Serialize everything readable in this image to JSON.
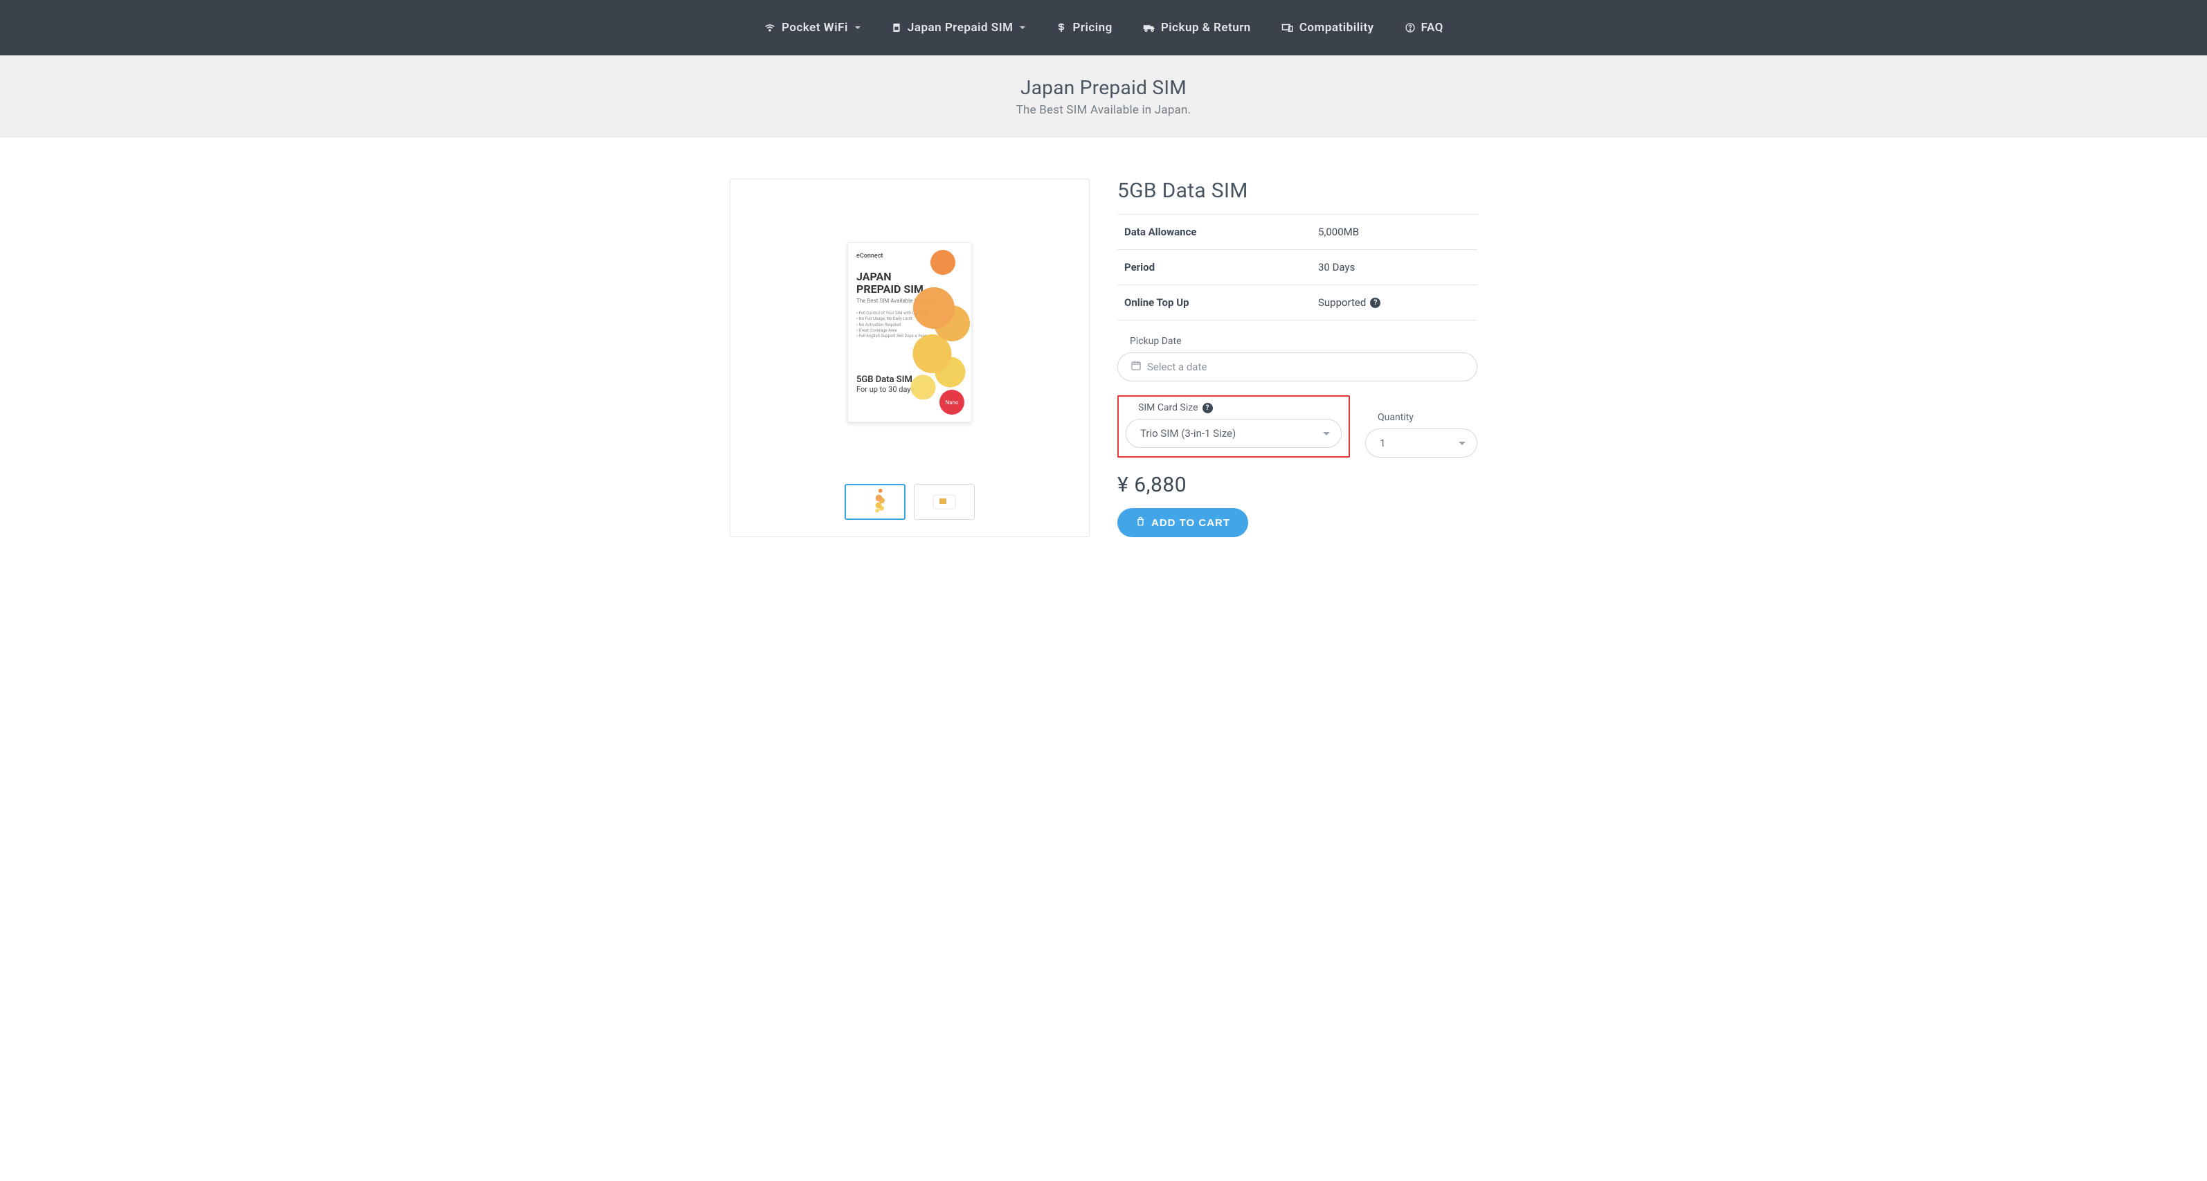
{
  "nav": {
    "items": [
      {
        "label": "Pocket WiFi",
        "has_dropdown": true
      },
      {
        "label": "Japan Prepaid SIM",
        "has_dropdown": true
      },
      {
        "label": "Pricing"
      },
      {
        "label": "Pickup & Return"
      },
      {
        "label": "Compatibility"
      },
      {
        "label": "FAQ"
      }
    ]
  },
  "hero": {
    "title": "Japan Prepaid SIM",
    "subtitle": "The Best SIM Available in Japan."
  },
  "product": {
    "title": "5GB Data SIM",
    "image": {
      "brand": "eConnect",
      "headline": "JAPAN\nPREPAID SIM",
      "tagline": "The Best SIM Available in Japan.",
      "bullets": "• Full Control of Your SIM with Our App\n• No Fair Usage, No Daily Limit\n• No Activation Required\n• Great Coverage Area\n• Full English Support 365 Days a Year",
      "data_line": "5GB Data SIM",
      "days_line": "For up to 30 days",
      "badge": "Nano"
    },
    "specs": [
      {
        "label": "Data Allowance",
        "value": "5,000MB"
      },
      {
        "label": "Period",
        "value": "30 Days"
      },
      {
        "label": "Online Top Up",
        "value": "Supported",
        "help": true
      }
    ],
    "pickup": {
      "label": "Pickup Date",
      "placeholder": "Select a date"
    },
    "sim_size": {
      "label": "SIM Card Size",
      "value": "Trio SIM (3-in-1 Size)"
    },
    "quantity": {
      "label": "Quantity",
      "value": "1"
    },
    "price": "¥ 6,880",
    "add_to_cart": "ADD TO CART"
  }
}
